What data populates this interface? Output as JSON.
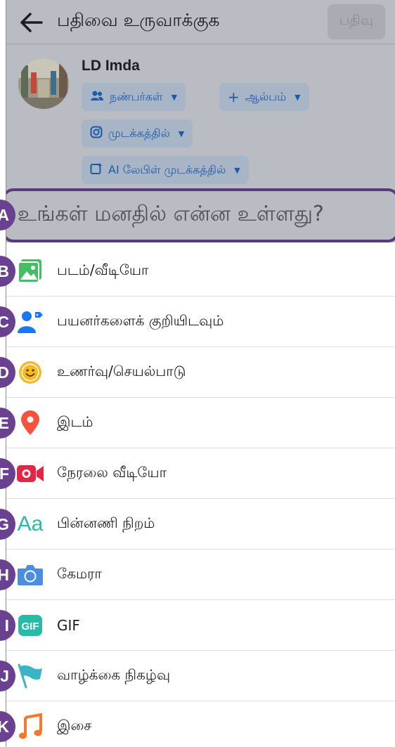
{
  "header": {
    "title": "பதிவை உருவாக்குக",
    "post_label": "பதிவு"
  },
  "user": {
    "name": "LD Imda"
  },
  "chips": {
    "friends": "நண்பர்கள்",
    "album": "ஆல்பம்",
    "instagram": "முடக்கத்தில்",
    "ai_label": "AI லேபிள் முடக்கத்தில்"
  },
  "composer": {
    "placeholder": "உங்கள் மனதில் என்ன உள்ளது?"
  },
  "options": [
    {
      "label": "படம்/வீடியோ",
      "icon": "photo-video-icon"
    },
    {
      "label": "பயனர்களைக் குறியிடவும்",
      "icon": "tag-people-icon"
    },
    {
      "label": "உணர்வு/செயல்பாடு",
      "icon": "feeling-smiley-icon"
    },
    {
      "label": "இடம்",
      "icon": "location-pin-icon"
    },
    {
      "label": "நேரலை வீடியோ",
      "icon": "live-video-icon"
    },
    {
      "label": "பின்னணி நிறம்",
      "icon": "background-color-icon"
    },
    {
      "label": "கேமரா",
      "icon": "camera-icon"
    },
    {
      "label": "GIF",
      "icon": "gif-icon"
    },
    {
      "label": "வாழ்க்கை நிகழ்வு",
      "icon": "life-event-flag-icon"
    },
    {
      "label": "இசை",
      "icon": "music-note-icon"
    }
  ],
  "annotation_badges": [
    "A",
    "B",
    "C",
    "D",
    "E",
    "F",
    "G",
    "H",
    "I",
    "J",
    "K"
  ],
  "colors": {
    "overlay_grey": "#b9bdc3",
    "chip_bg": "#a8b5c6",
    "chip_text": "#1b5aa8",
    "badge_purple": "#6a4190",
    "photo_green": "#45bd62",
    "tag_blue": "#1877f2",
    "smiley_yellow": "#f7b928",
    "pin_red": "#f5533d",
    "live_red": "#e42645",
    "aa_teal": "#2abba7",
    "camera_blue": "#4b8dde",
    "gif_teal": "#2abba7",
    "flag_teal": "#3ab4c6",
    "music_orange": "#f7782d"
  }
}
